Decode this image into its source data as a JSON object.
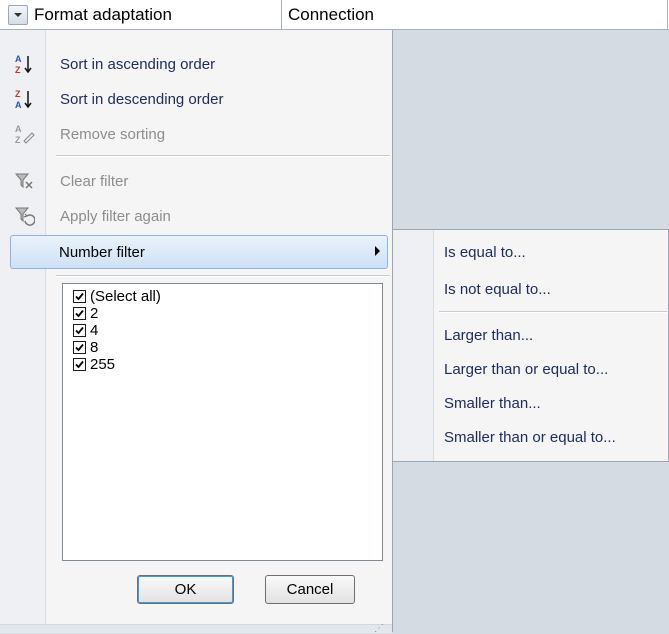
{
  "header": {
    "columns": [
      {
        "label": "Format adaptation",
        "has_dropdown": true
      },
      {
        "label": "Connection"
      }
    ]
  },
  "menu": {
    "items": [
      {
        "label": "Sort in ascending order",
        "icon": "sort-ascending-icon",
        "enabled": true
      },
      {
        "label": "Sort in descending order",
        "icon": "sort-descending-icon",
        "enabled": true
      },
      {
        "label": "Remove sorting",
        "icon": "remove-sorting-icon",
        "enabled": false
      },
      {
        "label": "Clear filter",
        "icon": "clear-filter-icon",
        "enabled": false
      },
      {
        "label": "Apply filter again",
        "icon": "reapply-filter-icon",
        "enabled": false
      },
      {
        "label": "Number filter",
        "enabled": true,
        "highlighted": true,
        "has_submenu": true
      }
    ]
  },
  "values": {
    "items": [
      {
        "label": "(Select all)",
        "checked": true
      },
      {
        "label": "2",
        "checked": true
      },
      {
        "label": "4",
        "checked": true
      },
      {
        "label": "8",
        "checked": true
      },
      {
        "label": "255",
        "checked": true
      }
    ]
  },
  "buttons": {
    "ok": "OK",
    "cancel": "Cancel"
  },
  "submenu": {
    "items": [
      {
        "label": "Is equal to..."
      },
      {
        "label": "Is not equal to..."
      },
      {
        "label": "Larger than..."
      },
      {
        "label": "Larger than or equal to..."
      },
      {
        "label": "Smaller than..."
      },
      {
        "label": "Smaller than or equal to..."
      }
    ]
  },
  "colors": {
    "menu_text": "#1d2b5e",
    "disabled_text": "#8d8d8d",
    "highlight_border": "#8eb3dc",
    "background": "#d4dbe3"
  }
}
